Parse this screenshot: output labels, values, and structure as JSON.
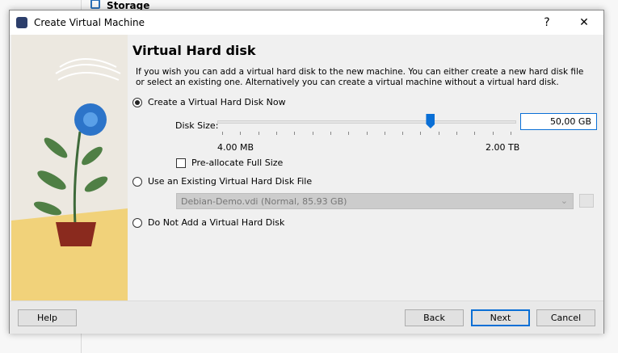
{
  "background": {
    "storage_label": "Storage"
  },
  "dialog": {
    "title": "Create Virtual Machine",
    "help_glyph": "?",
    "close_glyph": "✕"
  },
  "page": {
    "heading": "Virtual Hard disk",
    "description": "If you wish you can add a virtual hard disk to the new machine. You can either create a new hard disk file or select an existing one. Alternatively you can create a virtual machine without a virtual hard disk."
  },
  "options": {
    "create_now": {
      "label": "Create a Virtual Hard Disk Now",
      "selected": true
    },
    "disk_size_label": "Disk Size:",
    "disk_size_value": "50,00 GB",
    "slider_min": "4.00 MB",
    "slider_max": "2.00 TB",
    "slider_position_fraction": 0.71,
    "preallocate": {
      "label": "Pre-allocate Full Size",
      "checked": false
    },
    "use_existing": {
      "label": "Use an Existing Virtual Hard Disk File",
      "selected": false
    },
    "existing_file": "Debian-Demo.vdi (Normal, 85.93 GB)",
    "no_disk": {
      "label": "Do Not Add a Virtual Hard Disk",
      "selected": false
    }
  },
  "buttons": {
    "help": "Help",
    "back": "Back",
    "next": "Next",
    "cancel": "Cancel"
  },
  "colors": {
    "accent": "#0a6fd6"
  }
}
